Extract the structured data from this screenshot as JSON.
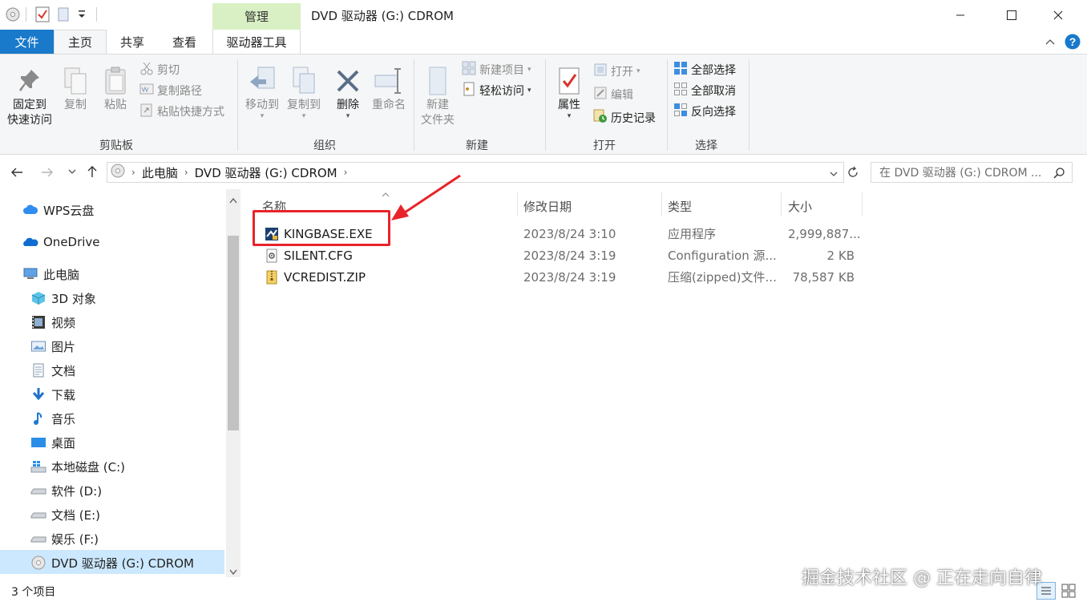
{
  "window": {
    "title": "DVD 驱动器 (G:) CDROM",
    "context_tab": "管理"
  },
  "tabs": {
    "file": "文件",
    "home": "主页",
    "share": "共享",
    "view": "查看",
    "drive_tools": "驱动器工具"
  },
  "ribbon": {
    "clipboard": {
      "label": "剪贴板",
      "pin": "固定到\n快速访问",
      "pin_line1": "固定到",
      "pin_line2": "快速访问",
      "copy": "复制",
      "paste": "粘贴",
      "cut": "剪切",
      "copy_path": "复制路径",
      "paste_shortcut": "粘贴快捷方式"
    },
    "organize": {
      "label": "组织",
      "move_to": "移动到",
      "copy_to": "复制到",
      "delete": "删除",
      "rename": "重命名"
    },
    "new": {
      "label": "新建",
      "new_folder_line1": "新建",
      "new_folder_line2": "文件夹",
      "new_item": "新建项目",
      "easy_access": "轻松访问"
    },
    "open": {
      "label": "打开",
      "properties": "属性",
      "open": "打开",
      "edit": "编辑",
      "history": "历史记录"
    },
    "select": {
      "label": "选择",
      "select_all": "全部选择",
      "select_none": "全部取消",
      "invert": "反向选择"
    }
  },
  "address": {
    "crumb1": "此电脑",
    "crumb2": "DVD 驱动器 (G:) CDROM",
    "search_placeholder": "在 DVD 驱动器 (G:) CDROM ..."
  },
  "nav": {
    "items": [
      {
        "label": "WPS云盘",
        "icon": "cloud-icon"
      },
      {
        "label": "OneDrive",
        "icon": "onedrive-icon"
      },
      {
        "label": "此电脑",
        "icon": "computer-icon"
      },
      {
        "label": "3D 对象",
        "icon": "cube-icon"
      },
      {
        "label": "视频",
        "icon": "video-icon"
      },
      {
        "label": "图片",
        "icon": "picture-icon"
      },
      {
        "label": "文档",
        "icon": "document-icon"
      },
      {
        "label": "下载",
        "icon": "download-icon"
      },
      {
        "label": "音乐",
        "icon": "music-icon"
      },
      {
        "label": "桌面",
        "icon": "desktop-icon"
      },
      {
        "label": "本地磁盘 (C:)",
        "icon": "windows-drive-icon"
      },
      {
        "label": "软件 (D:)",
        "icon": "drive-icon"
      },
      {
        "label": "文档 (E:)",
        "icon": "drive-icon"
      },
      {
        "label": "娱乐 (F:)",
        "icon": "drive-icon"
      },
      {
        "label": "DVD 驱动器 (G:) CDROM",
        "icon": "dvd-icon"
      }
    ]
  },
  "columns": {
    "name": "名称",
    "date": "修改日期",
    "type": "类型",
    "size": "大小"
  },
  "files": [
    {
      "name": "KINGBASE.EXE",
      "date": "2023/8/24 3:10",
      "type": "应用程序",
      "size": "2,999,887...",
      "icon": "exe-icon"
    },
    {
      "name": "SILENT.CFG",
      "date": "2023/8/24 3:19",
      "type": "Configuration 源...",
      "size": "2 KB",
      "icon": "config-file-icon"
    },
    {
      "name": "VCREDIST.ZIP",
      "date": "2023/8/24 3:19",
      "type": "压缩(zipped)文件...",
      "size": "78,587 KB",
      "icon": "zip-icon"
    }
  ],
  "status": {
    "count": "3 个项目"
  },
  "watermark": "掘金技术社区 @ 正在走向自律",
  "colors": {
    "accent": "#1979ca",
    "manage_tab": "#d9f0c4",
    "selection": "#cce8ff",
    "annotation_red": "#e8232a"
  }
}
